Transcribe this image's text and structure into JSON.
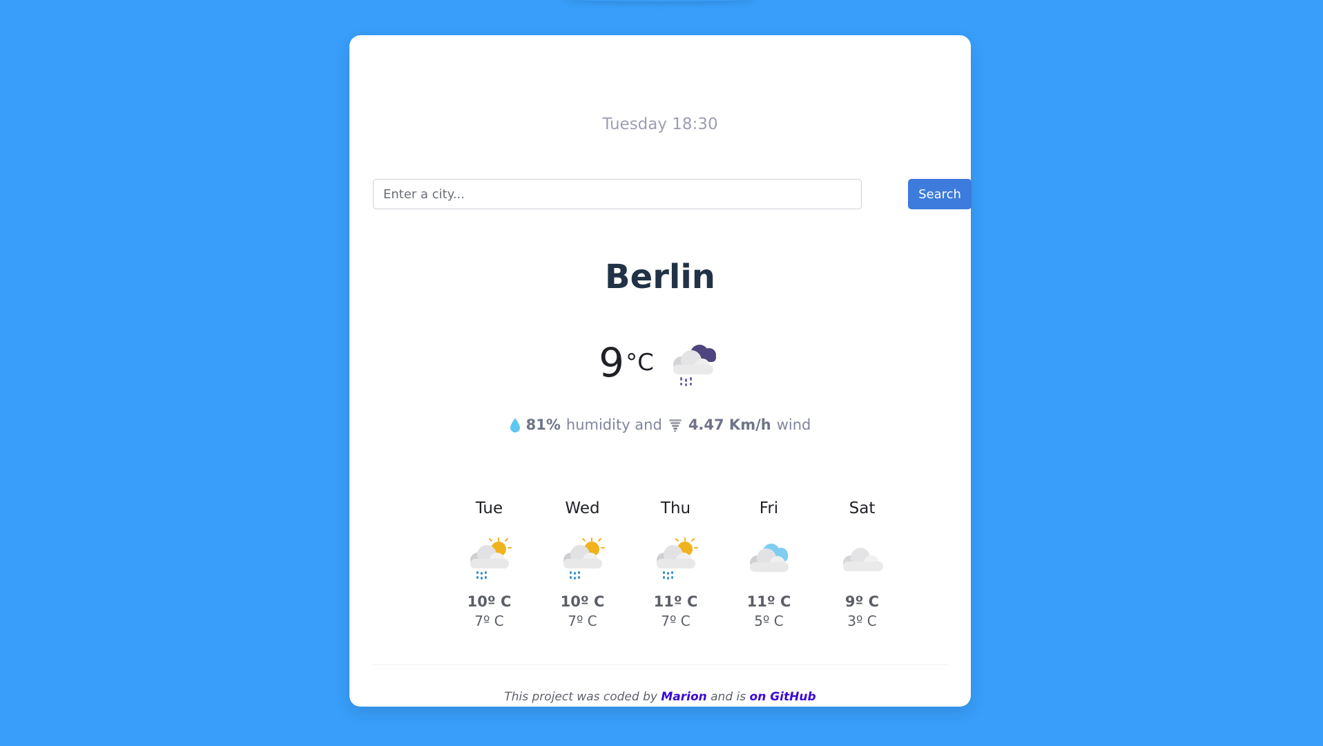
{
  "datetime": "Tuesday 18:30",
  "search": {
    "placeholder": "Enter a city...",
    "button_label": "Search"
  },
  "current": {
    "city": "Berlin",
    "temperature": "9",
    "unit": "°C",
    "icon": "rain-cloud-icon",
    "humidity_value": "81%",
    "humidity_label": "humidity and",
    "wind_value": "4.47 Km/h",
    "wind_label": "wind"
  },
  "forecast": [
    {
      "day": "Tue",
      "icon": "sun-cloud-rain-icon",
      "max": "10º C",
      "min": "7º C"
    },
    {
      "day": "Wed",
      "icon": "sun-cloud-rain-icon",
      "max": "10º C",
      "min": "7º C"
    },
    {
      "day": "Thu",
      "icon": "sun-cloud-rain-icon",
      "max": "11º C",
      "min": "7º C"
    },
    {
      "day": "Fri",
      "icon": "broken-clouds-icon",
      "max": "11º C",
      "min": "5º C"
    },
    {
      "day": "Sat",
      "icon": "cloud-icon",
      "max": "9º C",
      "min": "3º C"
    }
  ],
  "footer": {
    "text_before": "This project was coded by",
    "author_link": "Marion",
    "text_middle": "and is",
    "github_link": "on GitHub"
  },
  "colors": {
    "background": "#389efa",
    "button": "#3d7bdc",
    "link": "#3a09d6"
  }
}
